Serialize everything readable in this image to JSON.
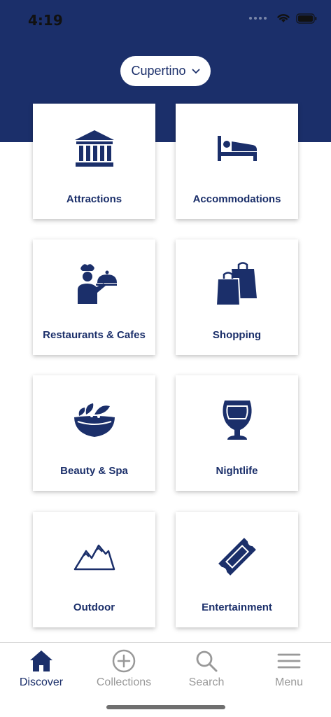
{
  "status_bar": {
    "time": "4:19"
  },
  "location": {
    "label": "Cupertino"
  },
  "categories": [
    {
      "label": "Attractions",
      "icon": "museum-icon"
    },
    {
      "label": "Accommodations",
      "icon": "bed-icon"
    },
    {
      "label": "Restaurants & Cafes",
      "icon": "chef-icon"
    },
    {
      "label": "Shopping",
      "icon": "shopping-bags-icon"
    },
    {
      "label": "Beauty & Spa",
      "icon": "spa-bowl-icon"
    },
    {
      "label": "Nightlife",
      "icon": "beer-glass-icon"
    },
    {
      "label": "Outdoor",
      "icon": "mountains-icon"
    },
    {
      "label": "Entertainment",
      "icon": "ticket-icon"
    }
  ],
  "tab_bar": {
    "tabs": [
      {
        "label": "Discover",
        "icon": "home-icon",
        "active": true
      },
      {
        "label": "Collections",
        "icon": "plus-circle-icon",
        "active": false
      },
      {
        "label": "Search",
        "icon": "search-icon",
        "active": false
      },
      {
        "label": "Menu",
        "icon": "hamburger-icon",
        "active": false
      }
    ]
  },
  "colors": {
    "brand": "#1b2f6a",
    "inactive": "#999999",
    "background": "#ffffff"
  }
}
